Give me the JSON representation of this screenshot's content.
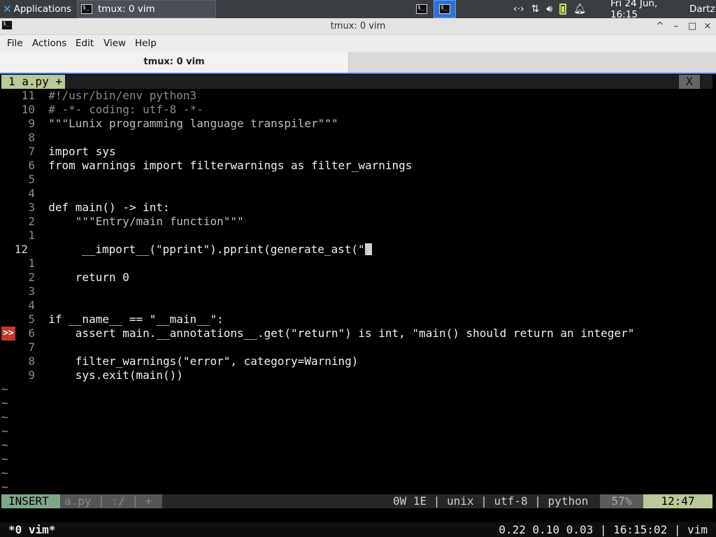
{
  "panel": {
    "applications_label": "Applications",
    "task_label": "tmux: 0 vim",
    "clock": "Fri 24 Jun, 16:15",
    "user": "Dartz"
  },
  "window": {
    "title": "tmux: 0 vim",
    "btn_min": "^",
    "btn_iconify": "–",
    "btn_max": "□",
    "btn_close": "×"
  },
  "menu": [
    "File",
    "Actions",
    "Edit",
    "View",
    "Help"
  ],
  "tab_label": "tmux: 0 vim",
  "vim": {
    "tabline": {
      "active": "1 a.py +",
      "close": "X"
    },
    "lines": [
      {
        "n": "11",
        "t": "#!/usr/bin/env python3"
      },
      {
        "n": "10",
        "t": "# -*- coding: utf-8 -*-"
      },
      {
        "n": "9",
        "t": "\"\"\"Lunix programming language transpiler\"\"\""
      },
      {
        "n": "8",
        "t": ""
      },
      {
        "n": "7",
        "t": "import sys"
      },
      {
        "n": "6",
        "t": "from warnings import filterwarnings as filter_warnings"
      },
      {
        "n": "5",
        "t": ""
      },
      {
        "n": "4",
        "t": ""
      },
      {
        "n": "3",
        "t": "def main() -> int:"
      },
      {
        "n": "2",
        "t": "    \"\"\"Entry/main function\"\"\""
      },
      {
        "n": "1",
        "t": ""
      },
      {
        "n": "12",
        "t": "    __import__(\"pprint\").pprint(generate_ast(\""
      },
      {
        "n": "1",
        "t": ""
      },
      {
        "n": "2",
        "t": "    return 0"
      },
      {
        "n": "3",
        "t": ""
      },
      {
        "n": "4",
        "t": ""
      },
      {
        "n": "5",
        "t": "if __name__ == \"__main__\":"
      },
      {
        "n": "6",
        "t": "    assert main.__annotations__.get(\"return\") is int, \"main() should return an integer\""
      },
      {
        "n": "7",
        "t": ""
      },
      {
        "n": "8",
        "t": "    filter_warnings(\"error\", category=Warning)"
      },
      {
        "n": "9",
        "t": "    sys.exit(main())"
      }
    ],
    "sign_text": ">>",
    "tilde": "~",
    "status": {
      "mode": "INSERT",
      "fileinfo": "a.py | :/ | +",
      "right": "0W 1E | unix | utf-8 | python",
      "percent": "57%",
      "position": "12:47"
    }
  },
  "tmux": {
    "window": "*0 vim*",
    "right": "0.22 0.10 0.03 | 16:15:02 | vim"
  }
}
